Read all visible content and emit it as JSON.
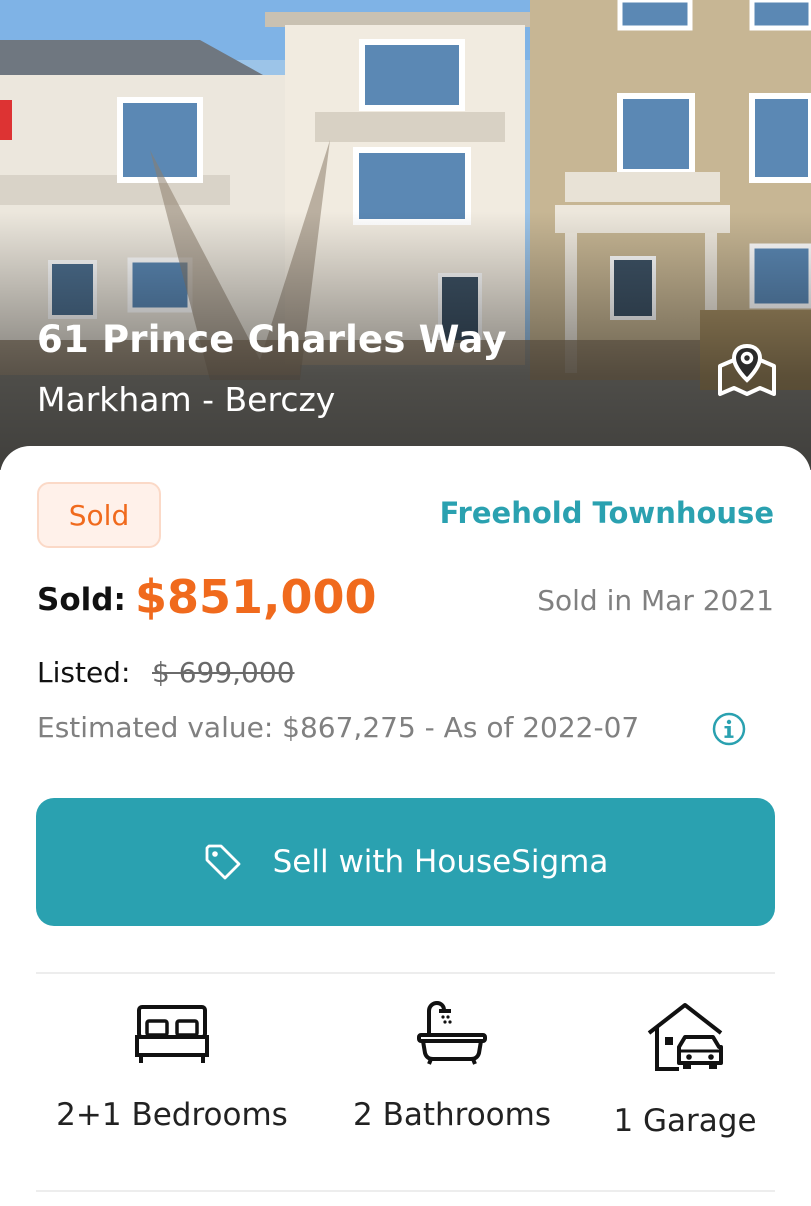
{
  "hero": {
    "address": "61 Prince Charles Way",
    "neighborhood": "Markham - Berczy",
    "map_icon": "map-pin-icon"
  },
  "listing": {
    "status": "Sold",
    "property_type": "Freehold Townhouse",
    "sold_label": "Sold:",
    "sold_price": "$851,000",
    "sold_date": "Sold in Mar 2021",
    "listed_label": "Listed:",
    "listed_price": "$ 699,000",
    "estimate_text": "Estimated value: $867,275 - As of 2022-07",
    "info_icon": "info-icon"
  },
  "actions": {
    "sell_label": "Sell with HouseSigma",
    "sell_icon": "tag-icon"
  },
  "features": [
    {
      "label": "2+1 Bedrooms",
      "icon": "bed-icon"
    },
    {
      "label": "2 Bathrooms",
      "icon": "bathtub-icon"
    },
    {
      "label": "1 Garage",
      "icon": "garage-icon"
    }
  ],
  "colors": {
    "accent_teal": "#2aa1b0",
    "sold_orange": "#f06a1d",
    "badge_bg": "#fff1ea"
  }
}
